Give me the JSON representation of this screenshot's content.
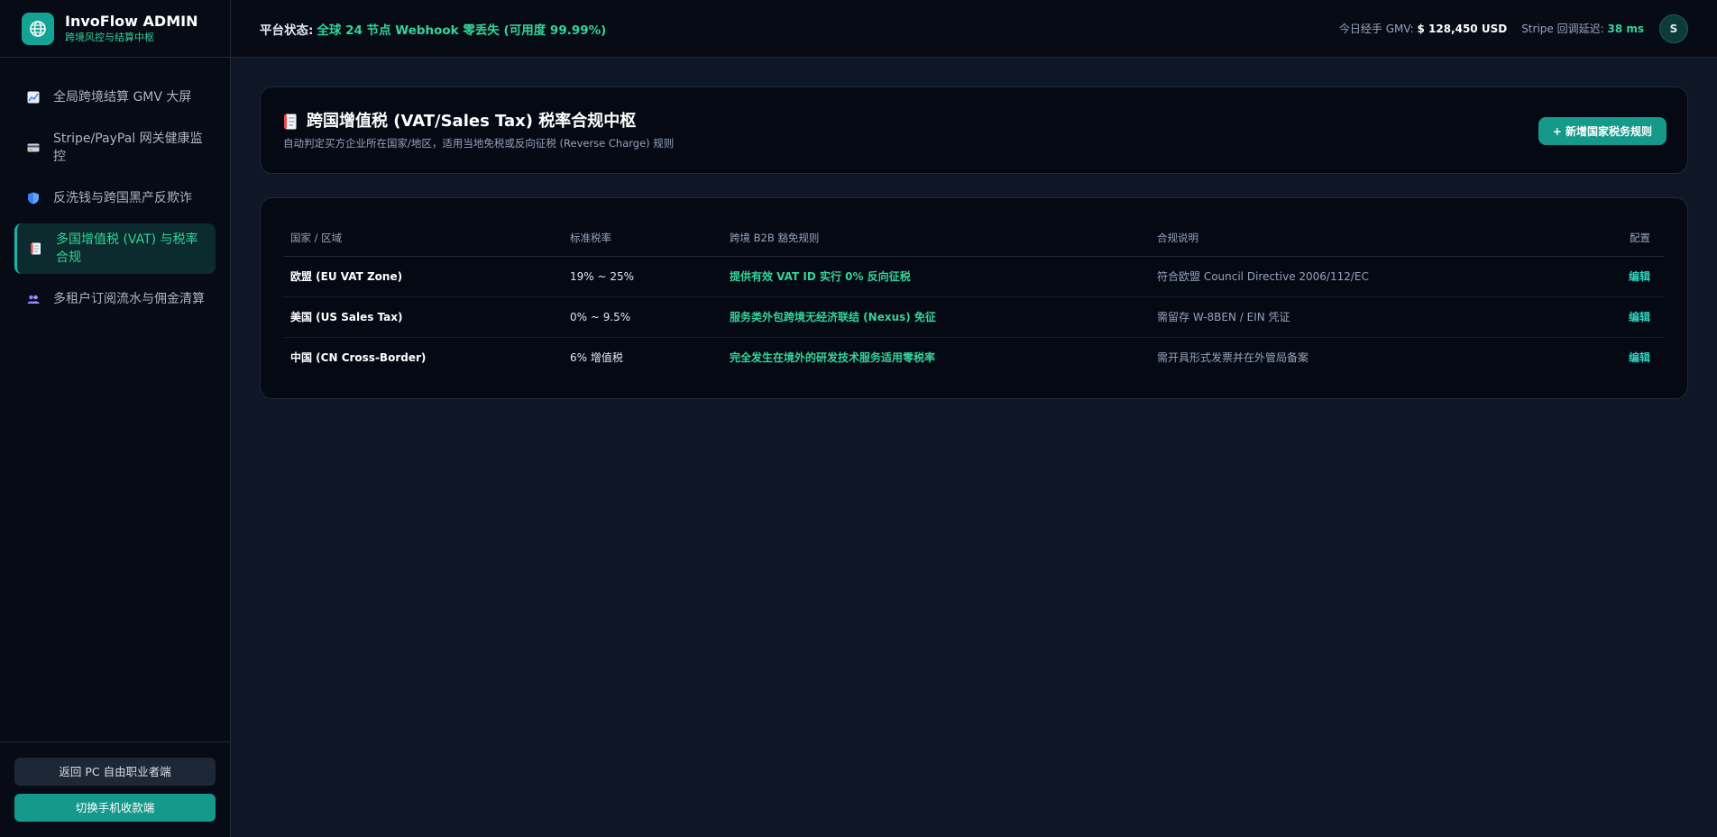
{
  "brand": {
    "title": "InvoFlow ADMIN",
    "subtitle": "跨境风控与结算中枢"
  },
  "sidebar": {
    "items": [
      {
        "label": "全局跨境结算 GMV 大屏",
        "icon": "chart-icon"
      },
      {
        "label": "Stripe/PayPal 网关健康监控",
        "icon": "credit-card-icon"
      },
      {
        "label": "反洗钱与跨国黑产反欺诈",
        "icon": "shield-icon"
      },
      {
        "label": "多国增值税 (VAT) 与税率合规",
        "icon": "document-icon",
        "active": true
      },
      {
        "label": "多租户订阅流水与佣金清算",
        "icon": "users-icon"
      }
    ],
    "back_button": "返回 PC 自由职业者端",
    "switch_button": "切换手机收款端"
  },
  "header": {
    "status_label": "平台状态:",
    "status_value": "全球 24 节点 Webhook 零丢失 (可用度 99.99%)",
    "gmv_label": "今日经手 GMV:",
    "gmv_value": "$ 128,450 USD",
    "latency_label": "Stripe 回调延迟:",
    "latency_value": "38 ms",
    "avatar": "S"
  },
  "page": {
    "title": "跨国增值税 (VAT/Sales Tax) 税率合规中枢",
    "subtitle": "自动判定买方企业所在国家/地区，适用当地免税或反向征税 (Reverse Charge) 规则",
    "add_button": "+ 新增国家税务规则"
  },
  "table": {
    "headers": [
      "国家 / 区域",
      "标准税率",
      "跨境 B2B 豁免规则",
      "合规说明",
      "配置"
    ],
    "rows": [
      {
        "region": "欧盟 (EU VAT Zone)",
        "rate": "19% ~ 25%",
        "rule": "提供有效 VAT ID 实行 0% 反向征税",
        "note": "符合欧盟 Council Directive 2006/112/EC",
        "action": "编辑"
      },
      {
        "region": "美国 (US Sales Tax)",
        "rate": "0% ~ 9.5%",
        "rule": "服务类外包跨境无经济联结 (Nexus) 免征",
        "note": "需留存 W-8BEN / EIN 凭证",
        "action": "编辑"
      },
      {
        "region": "中国 (CN Cross-Border)",
        "rate": "6% 增值税",
        "rule": "完全发生在境外的研发技术服务适用零税率",
        "note": "需开具形式发票并在外管局备案",
        "action": "编辑"
      }
    ]
  }
}
